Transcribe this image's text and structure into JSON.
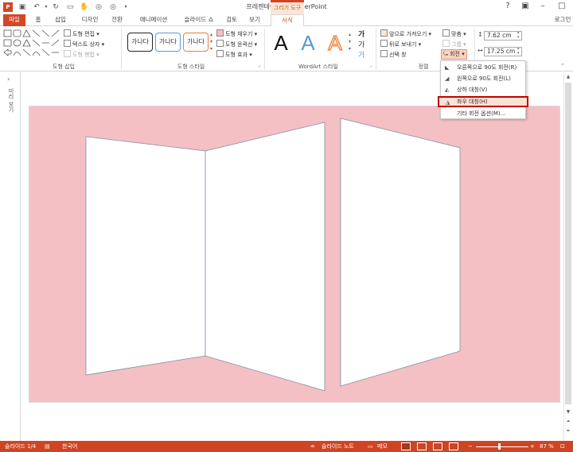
{
  "window": {
    "title": "프레젠테이션1 - PowerPoint",
    "context_group": "그리기 도구",
    "login_label": "로그인"
  },
  "tabs": [
    {
      "label": "파일"
    },
    {
      "label": "홈"
    },
    {
      "label": "삽입"
    },
    {
      "label": "디자인"
    },
    {
      "label": "전환"
    },
    {
      "label": "애니메이션"
    },
    {
      "label": "슬라이드 쇼"
    },
    {
      "label": "검토"
    },
    {
      "label": "보기"
    },
    {
      "label": "서식"
    }
  ],
  "ribbon": {
    "insert_shapes": {
      "label": "도형 삽입",
      "edit_shape": "도형 편집",
      "text_box": "텍스트 상자",
      "merge_shapes": "도형 병합"
    },
    "shape_styles": {
      "label": "도형 스타일",
      "preset_text": "가나다",
      "fill": "도형 채우기",
      "outline": "도형 윤곽선",
      "effects": "도형 효과"
    },
    "wordart": {
      "label": "WordArt 스타일",
      "letter": "A"
    },
    "arrange": {
      "label": "정렬",
      "bring_forward": "앞으로 가져오기",
      "send_backward": "뒤로 보내기",
      "selection_pane": "선택 창",
      "align": "맞춤",
      "group": "그룹",
      "rotate": "회전"
    },
    "size": {
      "height": "7.62 cm",
      "width": "17.25 cm"
    }
  },
  "rotate_menu": {
    "items": [
      {
        "label": "오른쪽으로 90도 회전(R)"
      },
      {
        "label": "왼쪽으로 90도 회전(L)"
      },
      {
        "label": "상하 대칭(V)"
      },
      {
        "label": "좌우 대칭(H)"
      },
      {
        "label": "기타 회전 옵션(M)..."
      }
    ],
    "highlighted_index": 3
  },
  "thumbnail_strip": {
    "collapsed_label": "미리 보기"
  },
  "status": {
    "slide_info": "슬라이드 1/4",
    "language": "한국어",
    "notes": "슬라이드 노트",
    "comments": "메모",
    "zoom": "87 %"
  },
  "colors": {
    "accent": "#d04423",
    "slide_background": "#f4c0c3",
    "menu_highlight_border": "#c00000"
  }
}
